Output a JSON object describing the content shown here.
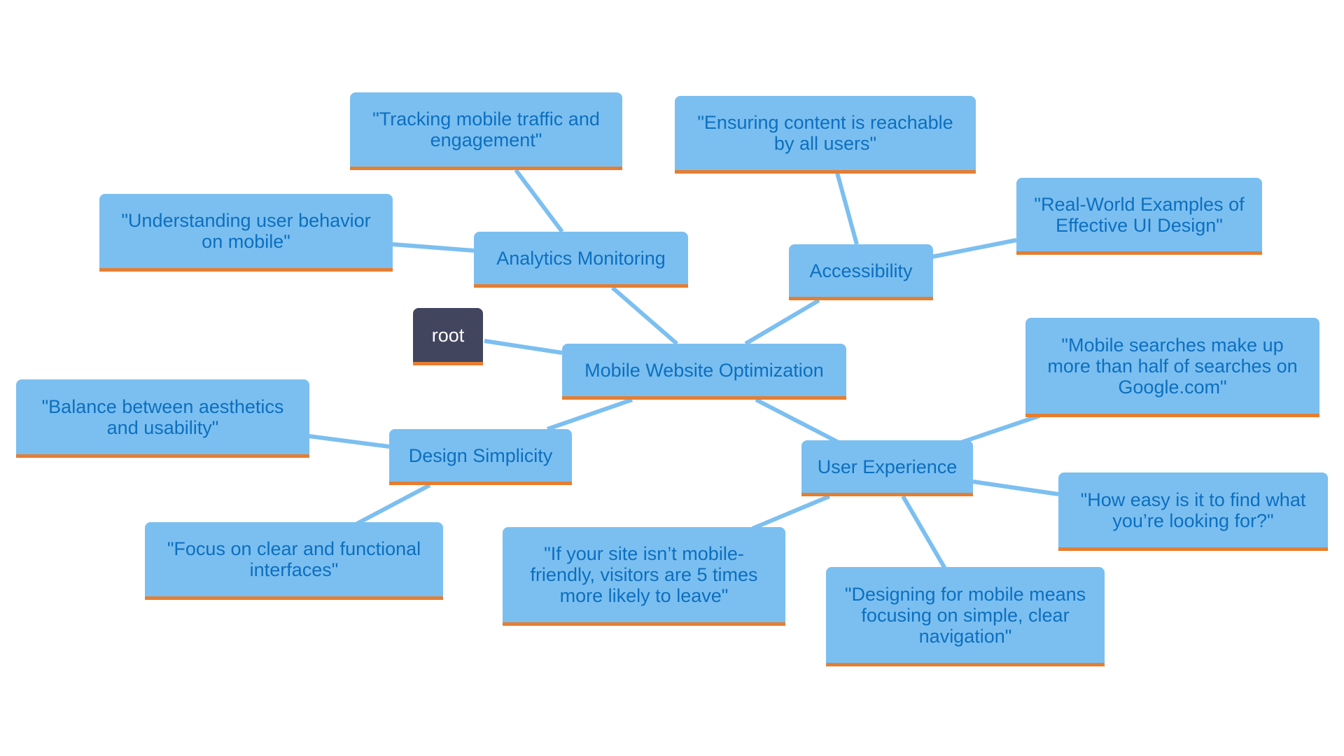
{
  "colors": {
    "node_fill": "#7bbff0",
    "node_text": "#0c6fbf",
    "node_underline": "#e67e30",
    "root_fill": "#41455e",
    "root_text": "#ffffff",
    "edge": "#7cbff0"
  },
  "nodes": {
    "root": "root",
    "main": "Mobile Website Optimization",
    "analytics": "Analytics Monitoring",
    "accessibility": "Accessibility",
    "design": "Design Simplicity",
    "ux": "User Experience",
    "tracking": "\"Tracking mobile traffic and engagement\"",
    "understanding": "\"Understanding user behavior on mobile\"",
    "ensuring": "\"Ensuring content is reachable by all users\"",
    "realworld": "\"Real-World Examples of Effective UI Design\"",
    "searches": "\"Mobile searches make up more than half of searches on Google.com\"",
    "howeasy": "\"How easy is it to find what you’re looking for?\"",
    "ifsite": "\"If your site isn’t mobile-friendly, visitors are 5 times more likely to leave\"",
    "designing": "\"Designing for mobile means focusing on simple, clear navigation\"",
    "balance": "\"Balance between aesthetics and usability\"",
    "focus": "\"Focus on clear and functional interfaces\""
  },
  "edges": [
    [
      "root",
      "main"
    ],
    [
      "main",
      "analytics"
    ],
    [
      "main",
      "accessibility"
    ],
    [
      "main",
      "design"
    ],
    [
      "main",
      "ux"
    ],
    [
      "analytics",
      "tracking"
    ],
    [
      "analytics",
      "understanding"
    ],
    [
      "accessibility",
      "ensuring"
    ],
    [
      "accessibility",
      "realworld"
    ],
    [
      "ux",
      "searches"
    ],
    [
      "ux",
      "howeasy"
    ],
    [
      "ux",
      "ifsite"
    ],
    [
      "ux",
      "designing"
    ],
    [
      "design",
      "balance"
    ],
    [
      "design",
      "focus"
    ]
  ]
}
